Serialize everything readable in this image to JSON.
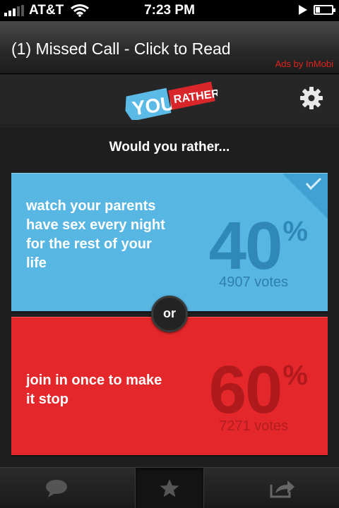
{
  "status_bar": {
    "carrier": "AT&T",
    "time": "7:23 PM"
  },
  "ad": {
    "text": "(1) Missed Call - Click to Read",
    "credit": "Ads by InMobi"
  },
  "logo": {
    "word1": "YOU",
    "word2": "RATHER"
  },
  "prompt": "Would you rather...",
  "options": [
    {
      "text": "watch your parents have sex every night for the rest of your life",
      "percent": "40",
      "percent_symbol": "%",
      "votes": "4907 votes",
      "selected": true,
      "color": "#58b6e3"
    },
    {
      "text": "join in once to make it stop",
      "percent": "60",
      "percent_symbol": "%",
      "votes": "7271 votes",
      "selected": false,
      "color": "#e3272a"
    }
  ],
  "divider_label": "or",
  "tabs": [
    {
      "icon": "comment-icon",
      "active": false
    },
    {
      "icon": "star-icon",
      "active": true
    },
    {
      "icon": "share-icon",
      "active": false
    }
  ]
}
